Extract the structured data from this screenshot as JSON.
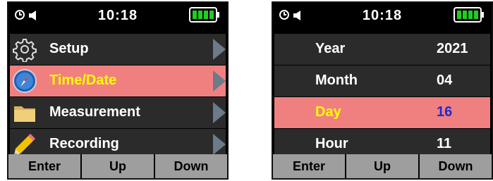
{
  "left_screen": {
    "status": {
      "time": "10:18",
      "clock_icon": "clock-icon",
      "speaker_icon": "speaker-icon",
      "battery_icon": "battery-full-icon"
    },
    "menu": [
      {
        "label": "Setup",
        "icon": "gear-icon",
        "selected": false
      },
      {
        "label": "Time/Date",
        "icon": "compass-icon",
        "selected": true
      },
      {
        "label": "Measurement",
        "icon": "folder-icon",
        "selected": false
      },
      {
        "label": "Recording",
        "icon": "pencil-icon",
        "selected": false
      }
    ],
    "softkeys": [
      "Enter",
      "Up",
      "Down"
    ]
  },
  "right_screen": {
    "status": {
      "time": "10:18",
      "clock_icon": "clock-icon",
      "speaker_icon": "speaker-icon",
      "battery_icon": "battery-full-icon"
    },
    "fields": [
      {
        "label": "Year",
        "value": "2021",
        "selected": false
      },
      {
        "label": "Month",
        "value": "04",
        "selected": false
      },
      {
        "label": "Day",
        "value": "16",
        "selected": true
      },
      {
        "label": "Hour",
        "value": "11",
        "selected": false
      }
    ],
    "softkeys": [
      "Enter",
      "Up",
      "Down"
    ]
  },
  "colors": {
    "highlight": "#f08080",
    "selected_text": "#ffff00",
    "selected_value": "#1e2bd0",
    "battery": "#22cc22",
    "softkey_bg": "#9e9e9e"
  }
}
